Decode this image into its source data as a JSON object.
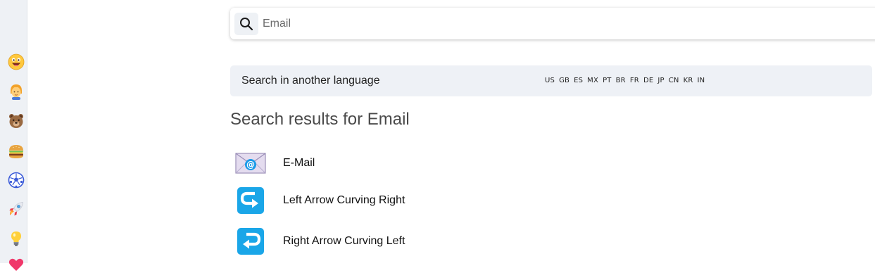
{
  "sidebar": {
    "items": [
      {
        "icon": "grinning-face-icon"
      },
      {
        "icon": "person-icon"
      },
      {
        "icon": "bear-icon"
      },
      {
        "icon": "hamburger-icon"
      },
      {
        "icon": "soccer-ball-icon"
      },
      {
        "icon": "rocket-icon"
      },
      {
        "icon": "light-bulb-icon"
      },
      {
        "icon": "heart-icon"
      }
    ]
  },
  "search": {
    "placeholder": "Email",
    "value": "",
    "icon": "search-icon"
  },
  "language_bar": {
    "label": "Search in another language",
    "languages": [
      "US",
      "GB",
      "ES",
      "MX",
      "PT",
      "BR",
      "FR",
      "DE",
      "JP",
      "CN",
      "KR",
      "IN"
    ]
  },
  "results": {
    "title": "Search results for Email",
    "items": [
      {
        "label": "E-Mail",
        "icon": "e-mail-icon"
      },
      {
        "label": "Left Arrow Curving Right",
        "icon": "left-arrow-curving-right-icon"
      },
      {
        "label": "Right Arrow Curving Left",
        "icon": "right-arrow-curving-left-icon"
      }
    ]
  },
  "colors": {
    "sidebar_bg": "#eef1f5",
    "lang_bar_bg": "#eef1f6",
    "arrow_icon_bg": "#1aa6e8"
  }
}
